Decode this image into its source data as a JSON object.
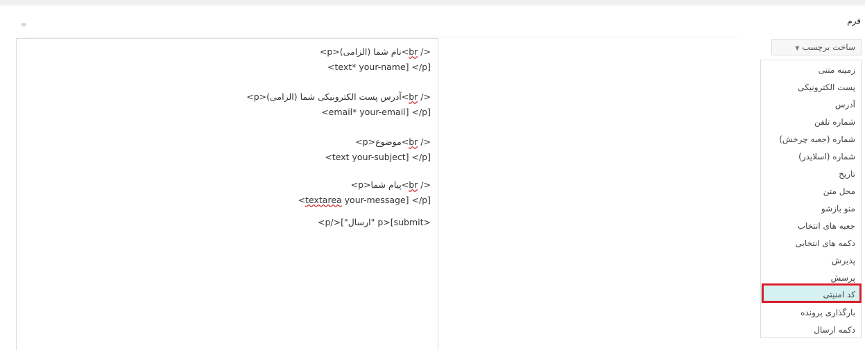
{
  "header": {
    "title": "فرم",
    "collapse_glyph": "≡"
  },
  "editor": {
    "lines": [
      [
        "<p>نام شما (الزامی)<",
        "br",
        " />"
      ],
      [
        "<text* your-name] </p]"
      ],
      [
        "<p>آدرس پست الکترونیکی شما (الزامی)<",
        "br",
        " />"
      ],
      [
        "<email* your-email] </p]"
      ],
      [
        "<p>موضوع<",
        "br",
        " />"
      ],
      [
        "<text your-subject] </p]"
      ],
      [
        "<p>پیام شما<",
        "br",
        " />"
      ],
      [
        "<",
        "textarea",
        " your-message] </p]"
      ],
      [
        "<p/>[\"ارسال\" p>[submit>"
      ]
    ]
  },
  "tag_generator": {
    "label": "ساخت برچسب",
    "caret": "▼"
  },
  "menu": {
    "items": [
      "زمینه متنی",
      "پست الکترونیکی",
      "آدرس",
      "شماره تلفن",
      "شماره (جعبه چرخش)",
      "شماره (اسلایدر)",
      "تاریخ",
      "محل متن",
      "منو بازشو",
      "جعبه های انتخاب",
      "دکمه های انتخابی",
      "پذیرش",
      "پرسش",
      "کد امنیتی",
      "بارگذاری پرونده",
      "دکمه ارسال"
    ],
    "selected_index": 13
  },
  "colors": {
    "highlight": "#d81e2a",
    "selected_bg": "#d6f1f1"
  }
}
